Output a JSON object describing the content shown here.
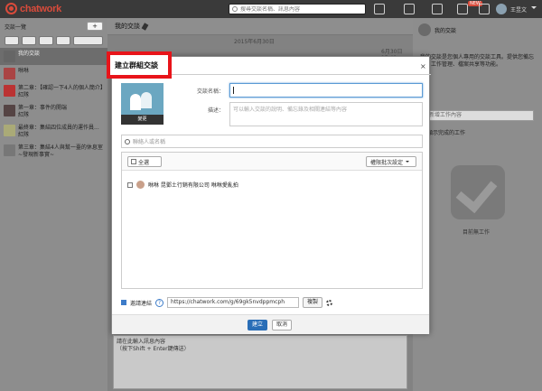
{
  "app": {
    "logo_text": "chatwork",
    "search_placeholder": "搜尋交談名稱、訊息內容",
    "new_badge": "NEW",
    "user_name": "王昱文"
  },
  "left": {
    "title": "交談一覽",
    "add_label": "+",
    "rooms": [
      {
        "line1": "我的交談",
        "line2": ""
      },
      {
        "line1": "咻咻",
        "line2": ""
      },
      {
        "line1": "第二章：【確認一下4人的個人簡介】",
        "line2": "紅隊"
      },
      {
        "line1": "第一章：事件的開端",
        "line2": "紅隊"
      },
      {
        "line1": "最終章：集結四位成員的運作員...",
        "line2": "紅隊"
      },
      {
        "line1": "第三章：集結4人與幫一臺的休息室",
        "line2": "~發現新事實~"
      }
    ]
  },
  "centre": {
    "title": "我的交談",
    "date_line": "2015年6月30日",
    "msg_time": "6月30日 15:41",
    "composer_line1": "請在此輸入訊息內容",
    "composer_line2": "（按下Shift + Enter鍵傳送）"
  },
  "right": {
    "title": "我的交談",
    "description": "我的交談是您個人專用的交談工具。提供您備忘錄、工作管理、檔案共享等功能。",
    "task_placeholder": "新增工作內容",
    "task_link": "顯示完成的工作",
    "done_text": "目前無工作"
  },
  "modal": {
    "title": "建立群組交談",
    "close": "×",
    "avatar_change": "變更",
    "name_label": "交談名稱：",
    "desc_label": "描述：",
    "desc_placeholder": "可以輸入交談的說明、備忘錄及相關連結等內容",
    "member_search_placeholder": "聯絡人或名稱",
    "select_all": "全選",
    "permission_button": "權限批次設定",
    "member_name": "咻咻 昆鄧土行銷有限公司 咻咻愛亂拍",
    "invite_label": "邀請連結",
    "help": "?",
    "invite_link": "https://chatwork.com/g/69gk5nvdppmcph",
    "copy_label": "複製",
    "create_label": "建立",
    "cancel_label": "取消"
  },
  "colors": {
    "highlight_frame": "#e8141a",
    "primary_button": "#2a6eb7",
    "logo": "#d94b3b"
  }
}
